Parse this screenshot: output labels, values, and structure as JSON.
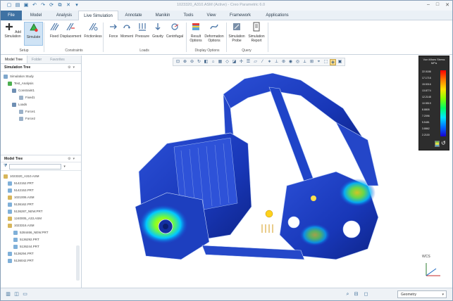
{
  "window": {
    "title": "1023320_A310.ASM (Active) - Creo Parametric 6.0"
  },
  "tabs": [
    "File",
    "Model",
    "Analysis",
    "Live Simulation",
    "Annotate",
    "Manikin",
    "Tools",
    "View",
    "Framework",
    "Applications"
  ],
  "active_tab": "Live Simulation",
  "ribbon": {
    "setup": {
      "add_sim": "Add Simulation",
      "simulate": "Simulate",
      "group": "Setup"
    },
    "constraints": {
      "fixed": "Fixed",
      "displacement": "Displacement",
      "frictionless": "Frictionless",
      "group": "Constraints"
    },
    "loads": {
      "force": "Force",
      "moment": "Moment",
      "pressure": "Pressure",
      "gravity": "Gravity",
      "centrifugal": "Centrifugal",
      "group": "Loads"
    },
    "display": {
      "result": "Result Options",
      "deformation": "Deformation Options",
      "group": "Display Options"
    },
    "query": {
      "probe": "Simulation Probe",
      "report": "Simulation Report",
      "group": "Query"
    }
  },
  "panel": {
    "tabs": [
      "Model Tree",
      "Folder",
      "Favorites"
    ],
    "sim_tree_header": "Simulation Tree",
    "sim_tree": [
      "Simulation Study",
      "Test_Analysis",
      "Constraint1",
      "Fixed1",
      "Loads",
      "Force1",
      "Force2"
    ],
    "model_tree_header": "Model Tree",
    "model_tree": [
      "1023320_A310.ASM",
      "5142152.PRT",
      "5142153.PRT",
      "1021006.ASM",
      "5136162.PRT",
      "5136287_NEW.PRT",
      "1240005_A33.ASM",
      "1023316.ASM",
      "5284466_NEW.PRT",
      "5136292.PRT",
      "5136244.PRT",
      "5136294.PRT",
      "5136042.PRT"
    ]
  },
  "legend": {
    "title": "Von Mises Stress",
    "unit": "MPa",
    "values": [
      "22.0186",
      "17.1716",
      "15.5316",
      "13.8774",
      "12.2148",
      "10.5519",
      "8.8805",
      "7.2096",
      "5.5481",
      "3.8862",
      "2.2100"
    ]
  },
  "wcs_label": "WCS",
  "statusbar": {
    "filter": "Geometry"
  },
  "colors": {
    "accent": "#3f72a3",
    "legend_bg": "#2d2d2d"
  }
}
